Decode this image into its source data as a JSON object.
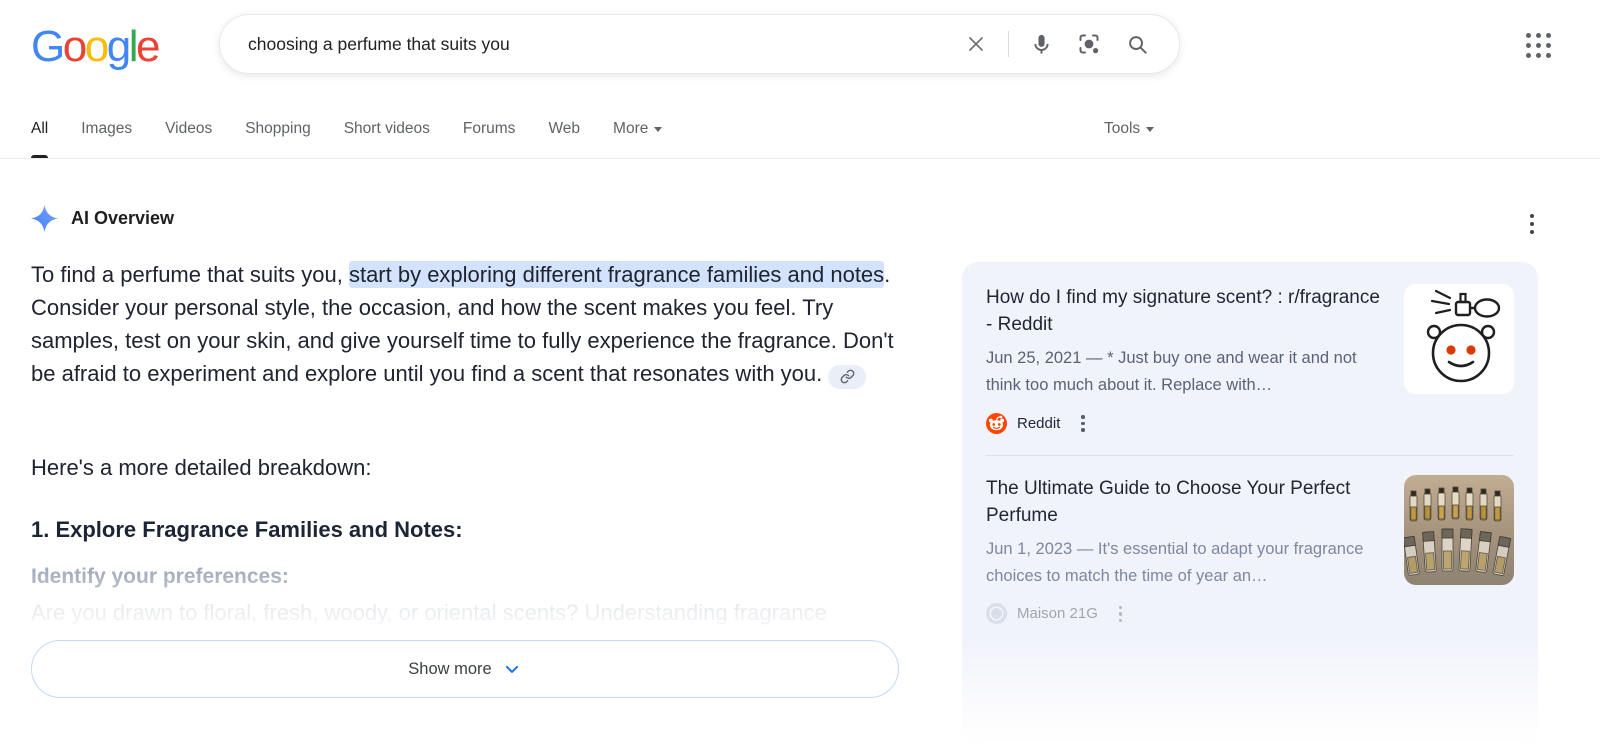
{
  "brand_colors": {
    "google_blue": "#4285F4",
    "google_red": "#EA4335",
    "google_yellow": "#FBBC05",
    "google_green": "#34A853",
    "accent_blue": "#1a73e8",
    "highlight_blue": "#d3e3fd",
    "reddit_orange": "#FF4500",
    "card_background": "#f1f3fb"
  },
  "logo": {
    "letters": [
      {
        "ch": "G"
      },
      {
        "ch": "o"
      },
      {
        "ch": "o"
      },
      {
        "ch": "g"
      },
      {
        "ch": "l"
      },
      {
        "ch": "e"
      }
    ]
  },
  "search": {
    "query": "choosing a perfume that suits you",
    "icons": [
      "clear-icon",
      "mic-icon",
      "lens-icon",
      "search-icon"
    ]
  },
  "tabs": {
    "items": [
      {
        "label": "All",
        "active": true
      },
      {
        "label": "Images"
      },
      {
        "label": "Videos"
      },
      {
        "label": "Shopping"
      },
      {
        "label": "Short videos"
      },
      {
        "label": "Forums"
      },
      {
        "label": "Web"
      },
      {
        "label": "More"
      }
    ],
    "tools_label": "Tools"
  },
  "ai_overview": {
    "label": "AI Overview",
    "paragraph": {
      "pre": "To find a perfume that suits you, ",
      "highlight": "start by exploring different fragrance families and notes",
      "post": ". Consider your personal style, the occasion, and how the scent makes you feel. Try samples, test on your skin, and give yourself time to fully experience the fragrance. Don't be afraid to experiment and explore until you find a scent that resonates with you."
    },
    "breakdown_intro": "Here's a more detailed breakdown:",
    "section_heading": "1. Explore Fragrance Families and Notes:",
    "sub_heading": "Identify your preferences:",
    "faded_line": "Are you drawn to floral, fresh, woody, or oriental scents? Understanding fragrance",
    "show_more_label": "Show more"
  },
  "source_cards": [
    {
      "title": "How do I find my signature scent? : r/fragrance - Reddit",
      "snippet": "Jun 25, 2021 — * Just buy one and wear it and not think too much about it. Replace with…",
      "source": "Reddit",
      "thumbnail": "reddit-snoo-perfume-drawing"
    },
    {
      "title": "The Ultimate Guide to Choose Your Perfect Perfume",
      "snippet": "Jun 1, 2023 — It's essential to adapt your fragrance choices to match the time of year an…",
      "source": "Maison 21G",
      "thumbnail": "perfume-vials-photo"
    }
  ]
}
